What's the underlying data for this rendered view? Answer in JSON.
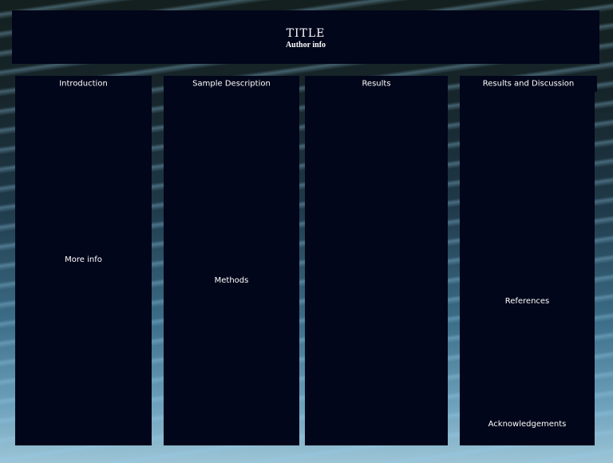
{
  "header": {
    "title": "TITLE",
    "author": "Author info"
  },
  "columns": [
    {
      "heading": "Introduction",
      "body": [
        "More info"
      ]
    },
    {
      "heading": "Sample Description",
      "body": [
        "Methods"
      ]
    },
    {
      "heading": "Results",
      "body": []
    },
    {
      "heading": "Results and Discussion",
      "body": [
        "References",
        "Acknowledgements"
      ]
    }
  ]
}
